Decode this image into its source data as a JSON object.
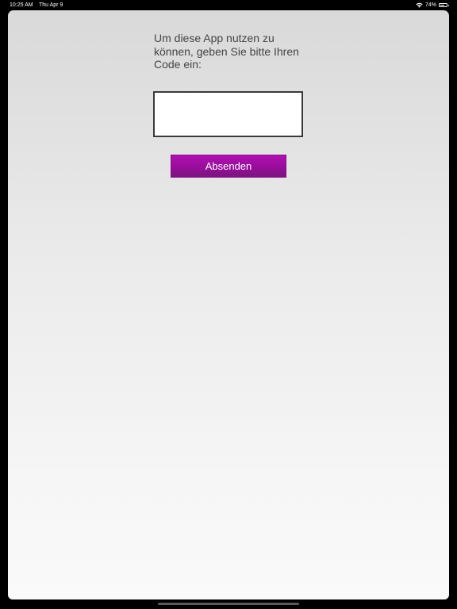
{
  "status_bar": {
    "time": "10:25 AM",
    "date": "Thu Apr 9",
    "battery_text": "74%",
    "battery_level": 0.74,
    "wifi_icon": "wifi-icon",
    "battery_icon": "battery-icon"
  },
  "main": {
    "instruction": "Um diese App nutzen zu können, geben Sie bitte Ihren Code ein:",
    "code_input_value": "",
    "submit_label": "Absenden"
  },
  "colors": {
    "accent": "#9b0c9e",
    "text": "#444444",
    "status_bar_bg": "#000000"
  }
}
